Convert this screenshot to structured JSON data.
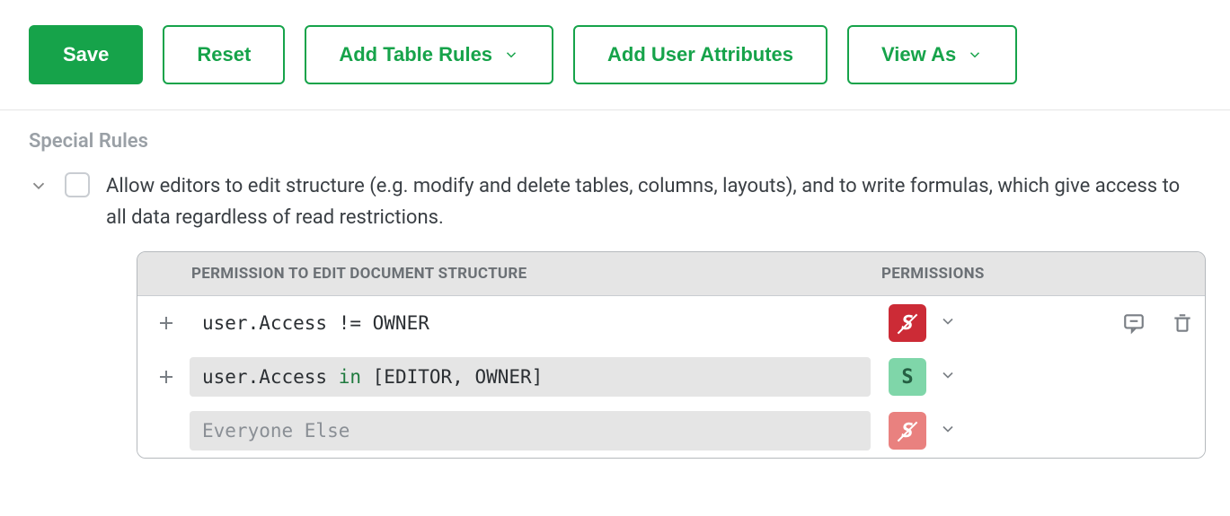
{
  "toolbar": {
    "save_label": "Save",
    "reset_label": "Reset",
    "add_table_rules_label": "Add Table Rules",
    "add_user_attrs_label": "Add User Attributes",
    "view_as_label": "View As"
  },
  "section": {
    "title": "Special Rules",
    "allow_editors_text": "Allow editors to edit structure (e.g. modify and delete tables, columns, layouts), and to write formulas, which give access to all data regardless of read restrictions.",
    "allow_editors_checked": false
  },
  "perm_table": {
    "col_condition": "PERMISSION TO EDIT DOCUMENT STRUCTURE",
    "col_permissions": "PERMISSIONS",
    "rows": [
      {
        "condition_prefix": "user.Access != ",
        "condition_keyword": "",
        "condition_suffix": "OWNER",
        "boxed": false,
        "badge_letter": "S",
        "badge_style": "red",
        "badge_strike": true,
        "show_actions": true
      },
      {
        "condition_prefix": "user.Access ",
        "condition_keyword": "in",
        "condition_suffix": " [EDITOR, OWNER]",
        "boxed": true,
        "badge_letter": "S",
        "badge_style": "green",
        "badge_strike": false,
        "show_actions": false
      },
      {
        "condition_prefix": "Everyone Else",
        "condition_keyword": "",
        "condition_suffix": "",
        "boxed": true,
        "placeholder": true,
        "badge_letter": "S",
        "badge_style": "pink",
        "badge_strike": true,
        "show_actions": false,
        "no_add": true
      }
    ]
  }
}
